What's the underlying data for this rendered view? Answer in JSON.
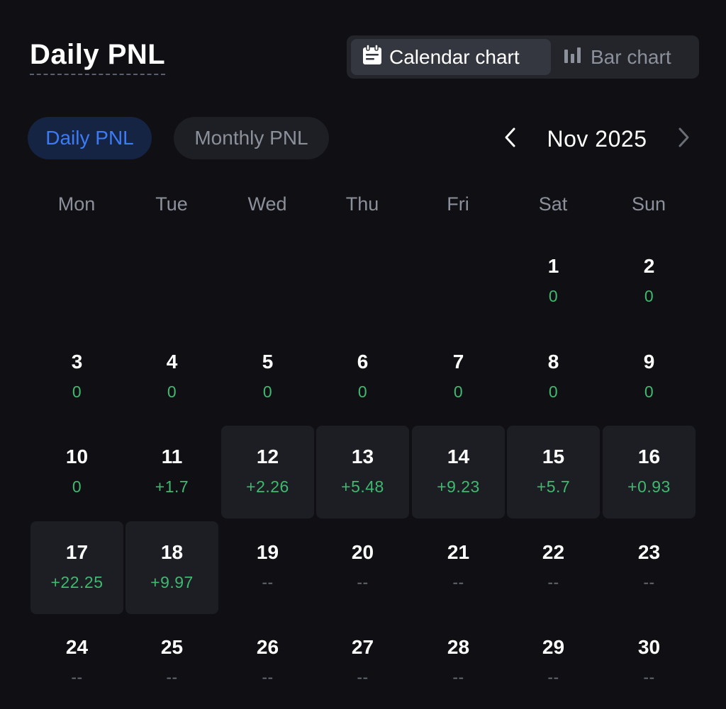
{
  "header": {
    "title": "Daily PNL"
  },
  "view_toggle": {
    "calendar_label": "Calendar chart",
    "bar_label": "Bar chart",
    "active": "calendar"
  },
  "tabs": {
    "daily_label": "Daily PNL",
    "monthly_label": "Monthly PNL",
    "active": "daily"
  },
  "month_nav": {
    "label": "Nov 2025"
  },
  "weekdays": [
    "Mon",
    "Tue",
    "Wed",
    "Thu",
    "Fri",
    "Sat",
    "Sun"
  ],
  "colors": {
    "background": "#101014",
    "positive": "#3fb96f",
    "accent": "#3d7bf5",
    "muted": "#8c909a"
  },
  "days": [
    {
      "day": "1",
      "pnl": "0",
      "traded": false
    },
    {
      "day": "2",
      "pnl": "0",
      "traded": false
    },
    {
      "day": "3",
      "pnl": "0",
      "traded": false
    },
    {
      "day": "4",
      "pnl": "0",
      "traded": false
    },
    {
      "day": "5",
      "pnl": "0",
      "traded": false
    },
    {
      "day": "6",
      "pnl": "0",
      "traded": false
    },
    {
      "day": "7",
      "pnl": "0",
      "traded": false
    },
    {
      "day": "8",
      "pnl": "0",
      "traded": false
    },
    {
      "day": "9",
      "pnl": "0",
      "traded": false
    },
    {
      "day": "10",
      "pnl": "0",
      "traded": false
    },
    {
      "day": "11",
      "pnl": "+1.7",
      "traded": false
    },
    {
      "day": "12",
      "pnl": "+2.26",
      "traded": true
    },
    {
      "day": "13",
      "pnl": "+5.48",
      "traded": true
    },
    {
      "day": "14",
      "pnl": "+9.23",
      "traded": true
    },
    {
      "day": "15",
      "pnl": "+5.7",
      "traded": true
    },
    {
      "day": "16",
      "pnl": "+0.93",
      "traded": true
    },
    {
      "day": "17",
      "pnl": "+22.25",
      "traded": true
    },
    {
      "day": "18",
      "pnl": "+9.97",
      "traded": true
    },
    {
      "day": "19",
      "pnl": "--",
      "traded": false
    },
    {
      "day": "20",
      "pnl": "--",
      "traded": false
    },
    {
      "day": "21",
      "pnl": "--",
      "traded": false
    },
    {
      "day": "22",
      "pnl": "--",
      "traded": false
    },
    {
      "day": "23",
      "pnl": "--",
      "traded": false
    },
    {
      "day": "24",
      "pnl": "--",
      "traded": false
    },
    {
      "day": "25",
      "pnl": "--",
      "traded": false
    },
    {
      "day": "26",
      "pnl": "--",
      "traded": false
    },
    {
      "day": "27",
      "pnl": "--",
      "traded": false
    },
    {
      "day": "28",
      "pnl": "--",
      "traded": false
    },
    {
      "day": "29",
      "pnl": "--",
      "traded": false
    },
    {
      "day": "30",
      "pnl": "--",
      "traded": false
    }
  ]
}
